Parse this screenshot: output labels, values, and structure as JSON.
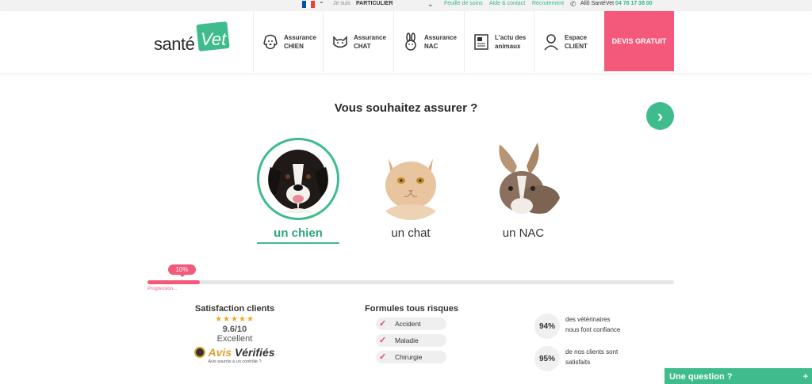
{
  "topbar": {
    "je_suis": "Je suis",
    "profile": "PARTICULIER",
    "links": [
      "Feuille de soins",
      "Aide & contact",
      "Recrutement"
    ],
    "allo_label": "Allô SantéVet",
    "phone": "04 78 17 38 00",
    "flag_colors": [
      "#0055a4",
      "#ffffff",
      "#ef4135"
    ]
  },
  "logo": {
    "part1": "santé",
    "part2": "Vet"
  },
  "nav": {
    "items": [
      {
        "label_line1": "Assurance",
        "label_line2": "CHIEN",
        "icon": "dog-icon"
      },
      {
        "label_line1": "Assurance",
        "label_line2": "CHAT",
        "icon": "cat-icon"
      },
      {
        "label_line1": "Assurance",
        "label_line2": "NAC",
        "icon": "rabbit-icon"
      },
      {
        "label_line1": "L'actu des",
        "label_line2": "animaux",
        "icon": "newspaper-icon"
      },
      {
        "label_line1": "Espace",
        "label_line2": "CLIENT",
        "icon": "user-icon"
      }
    ],
    "cta": "DEVIS GRATUIT"
  },
  "main": {
    "question": "Vous souhaitez assurer ?",
    "animals": [
      {
        "label": "un chien",
        "selected": true
      },
      {
        "label": "un chat",
        "selected": false
      },
      {
        "label": "un NAC",
        "selected": false
      }
    ]
  },
  "progress": {
    "percent_label": "10%",
    "value": 0.1,
    "label": "Progression..."
  },
  "satisfaction": {
    "title": "Satisfaction clients",
    "stars": "★★★★★",
    "score": "9.6/10",
    "rating_label": "Excellent",
    "brand_part1": "Avis",
    "brand_part2": "Vérifiés",
    "note": "Avis soumis à un contrôle"
  },
  "formules": {
    "title": "Formules tous risques",
    "items": [
      "Accident",
      "Maladie",
      "Chirurgie"
    ]
  },
  "stats": [
    {
      "value": "94%",
      "text_line1": "des vétérinaires",
      "text_line2": "nous font confiance"
    },
    {
      "value": "95%",
      "text_line1": "de nos clients sont",
      "text_line2": "satisfaits"
    }
  ],
  "chat_widget": {
    "label": "Une question ?",
    "plus": "+"
  },
  "colors": {
    "accent": "#3fbc8d",
    "pink": "#f4587a"
  }
}
